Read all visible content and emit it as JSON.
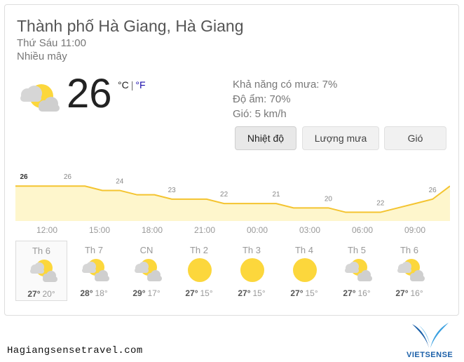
{
  "location": "Thành phố Hà Giang, Hà Giang",
  "datetime": "Thứ Sáu 11:00",
  "condition": "Nhiều mây",
  "current": {
    "temp": "26",
    "unit_c": "°C",
    "unit_sep": "|",
    "unit_f": "°F",
    "icon": "partly-cloudy-icon"
  },
  "details": {
    "rain": "Khả năng có mưa: 7%",
    "humidity": "Độ ẩm: 70%",
    "wind": "Gió: 5 km/h"
  },
  "tabs": [
    {
      "label": "Nhiệt độ",
      "active": true
    },
    {
      "label": "Lượng mưa",
      "active": false
    },
    {
      "label": "Gió",
      "active": false
    }
  ],
  "chart_data": {
    "type": "area",
    "categories": [
      "12:00",
      "15:00",
      "18:00",
      "21:00",
      "00:00",
      "03:00",
      "06:00",
      "09:00"
    ],
    "point_labels": [
      "26",
      "26",
      "24",
      "23",
      "22",
      "21",
      "20",
      "22",
      "26"
    ],
    "x": [
      11,
      12,
      13,
      14,
      15,
      16,
      17,
      18,
      19,
      20,
      21,
      22,
      23,
      0,
      1,
      2,
      3,
      4,
      5,
      6,
      7,
      8,
      9,
      10,
      11
    ],
    "values": [
      26,
      26,
      26,
      26,
      26,
      25,
      25,
      24,
      24,
      23,
      23,
      23,
      22,
      22,
      22,
      22,
      21,
      21,
      21,
      20,
      20,
      20,
      21,
      22,
      23,
      26
    ],
    "colors": {
      "line": "#f4c430",
      "fill": "#fef6cc"
    }
  },
  "forecast": [
    {
      "day": "Th 6",
      "hi": "27°",
      "lo": "20°",
      "icon": "partly-cloudy-icon",
      "selected": true
    },
    {
      "day": "Th 7",
      "hi": "28°",
      "lo": "18°",
      "icon": "partly-cloudy-icon",
      "selected": false
    },
    {
      "day": "CN",
      "hi": "29°",
      "lo": "17°",
      "icon": "partly-cloudy-icon",
      "selected": false
    },
    {
      "day": "Th 2",
      "hi": "27°",
      "lo": "15°",
      "icon": "sunny-icon",
      "selected": false
    },
    {
      "day": "Th 3",
      "hi": "27°",
      "lo": "15°",
      "icon": "sunny-icon",
      "selected": false
    },
    {
      "day": "Th 4",
      "hi": "27°",
      "lo": "15°",
      "icon": "sunny-icon",
      "selected": false
    },
    {
      "day": "Th 5",
      "hi": "27°",
      "lo": "16°",
      "icon": "partly-cloudy-icon",
      "selected": false
    },
    {
      "day": "Th 6",
      "hi": "27°",
      "lo": "16°",
      "icon": "partly-cloudy-icon",
      "selected": false
    }
  ],
  "footer": {
    "site": "Hagiangsensetravel.com",
    "brand": "VIETSENSE"
  }
}
